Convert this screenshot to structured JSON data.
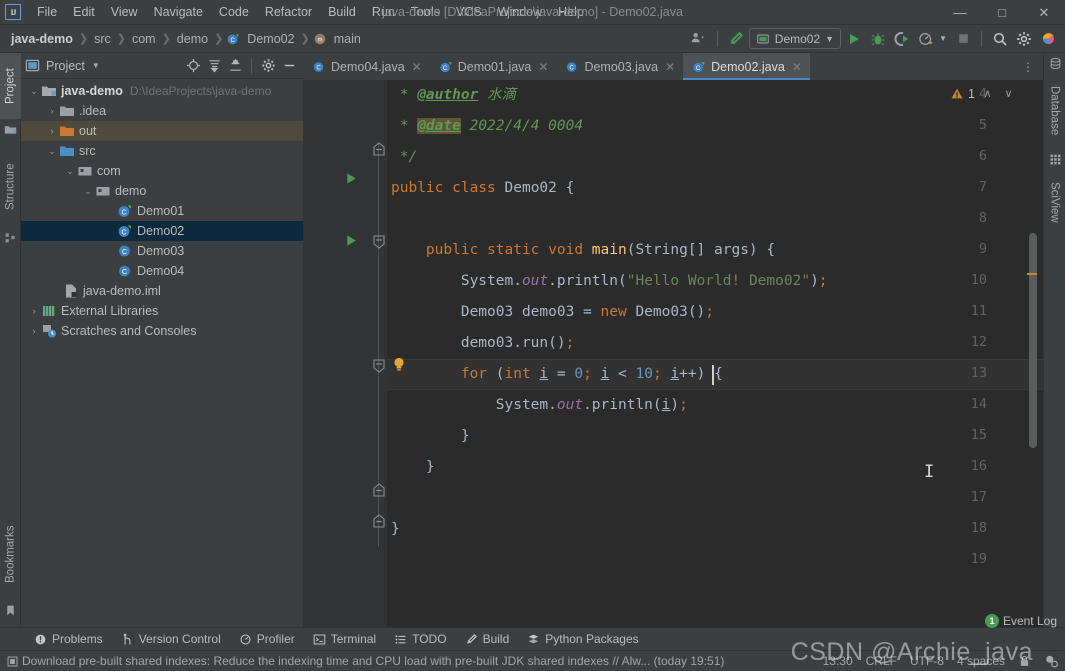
{
  "window": {
    "title": "java-demo [D:\\IdeaProjects\\java-demo] - Demo02.java",
    "logo": "IJ",
    "minimize": "—",
    "maximize": "□",
    "close": "✕"
  },
  "menu": [
    "File",
    "Edit",
    "View",
    "Navigate",
    "Code",
    "Refactor",
    "Build",
    "Run",
    "Tools",
    "VCS",
    "Window",
    "Help"
  ],
  "breadcrumb": [
    {
      "label": "java-demo",
      "icon": ""
    },
    {
      "label": "src",
      "icon": ""
    },
    {
      "label": "com",
      "icon": ""
    },
    {
      "label": "demo",
      "icon": ""
    },
    {
      "label": "Demo02",
      "icon": "class-icon"
    },
    {
      "label": "main",
      "icon": "method-icon"
    }
  ],
  "toolbar": {
    "run_config": "Demo02",
    "buttons": [
      "people-icon",
      "hammer-icon",
      "run-icon",
      "debug-icon",
      "coverage-icon",
      "profile-icon",
      "stop-icon",
      "search-icon",
      "settings-icon",
      "plugin-icon"
    ]
  },
  "left_stripe": [
    {
      "label": "Project",
      "active": true
    },
    {
      "label": "Structure",
      "active": false
    },
    {
      "label": "Bookmarks",
      "active": false
    }
  ],
  "right_stripe": [
    {
      "label": "Database"
    },
    {
      "label": "SciView"
    }
  ],
  "project_panel": {
    "title": "Project",
    "tools": [
      "locate-icon",
      "expand-all-icon",
      "collapse-all-icon",
      "gear-icon",
      "minimize-icon"
    ],
    "tree": [
      {
        "label": "java-demo",
        "path": "D:\\IdeaProjects\\java-demo",
        "indent": 0,
        "arrow": "⌄",
        "icon": "module-icon",
        "bold": true,
        "state": "normal"
      },
      {
        "label": ".idea",
        "path": "",
        "indent": 1,
        "arrow": "›",
        "icon": "folder-gray-icon",
        "bold": false,
        "state": "normal"
      },
      {
        "label": "out",
        "path": "",
        "indent": 1,
        "arrow": "›",
        "icon": "folder-orange-icon",
        "bold": false,
        "state": "hover"
      },
      {
        "label": "src",
        "path": "",
        "indent": 1,
        "arrow": "⌄",
        "icon": "folder-blue-icon",
        "bold": false,
        "state": "normal"
      },
      {
        "label": "com",
        "path": "",
        "indent": 2,
        "arrow": "⌄",
        "icon": "package-icon",
        "bold": false,
        "state": "normal"
      },
      {
        "label": "demo",
        "path": "",
        "indent": 3,
        "arrow": "⌄",
        "icon": "package-icon",
        "bold": false,
        "state": "normal"
      },
      {
        "label": "Demo01",
        "path": "",
        "indent": 4,
        "arrow": "",
        "icon": "class-run-icon",
        "bold": false,
        "state": "normal"
      },
      {
        "label": "Demo02",
        "path": "",
        "indent": 4,
        "arrow": "",
        "icon": "class-run-icon",
        "bold": false,
        "state": "selected"
      },
      {
        "label": "Demo03",
        "path": "",
        "indent": 4,
        "arrow": "",
        "icon": "class-icon",
        "bold": false,
        "state": "normal"
      },
      {
        "label": "Demo04",
        "path": "",
        "indent": 4,
        "arrow": "",
        "icon": "class-icon",
        "bold": false,
        "state": "normal"
      },
      {
        "label": "java-demo.iml",
        "path": "",
        "indent": 2,
        "arrow": "",
        "icon": "iml-icon",
        "bold": false,
        "state": "normal"
      },
      {
        "label": "External Libraries",
        "path": "",
        "indent": 0,
        "arrow": "›",
        "icon": "libraries-icon",
        "bold": false,
        "state": "normal"
      },
      {
        "label": "Scratches and Consoles",
        "path": "",
        "indent": 0,
        "arrow": "›",
        "icon": "scratches-icon",
        "bold": false,
        "state": "normal"
      }
    ]
  },
  "editor": {
    "tabs": [
      {
        "label": "Demo04.java",
        "icon": "class-icon",
        "active": false
      },
      {
        "label": "Demo01.java",
        "icon": "class-run-icon",
        "active": false
      },
      {
        "label": "Demo03.java",
        "icon": "class-icon",
        "active": false
      },
      {
        "label": "Demo02.java",
        "icon": "class-run-icon",
        "active": true
      }
    ],
    "tab_close": "✕",
    "tabs_more": "⋮",
    "inspection": {
      "count": "1",
      "up": "∧",
      "down": "∨"
    },
    "first_line": 4,
    "lines": [
      {
        "num": "4",
        "text": " * @author 水滴"
      },
      {
        "num": "5",
        "text": " * @date 2022/4/4 0004"
      },
      {
        "num": "6",
        "text": " */"
      },
      {
        "num": "7",
        "text": "public class Demo02 {"
      },
      {
        "num": "8",
        "text": ""
      },
      {
        "num": "9",
        "text": "    public static void main(String[] args) {"
      },
      {
        "num": "10",
        "text": "        System.out.println(\"Hello World! Demo02\");"
      },
      {
        "num": "11",
        "text": "        Demo03 demo03 = new Demo03();"
      },
      {
        "num": "12",
        "text": "        demo03.run();"
      },
      {
        "num": "13",
        "text": "        for (int i = 0; i < 10; i++) {"
      },
      {
        "num": "14",
        "text": "            System.out.println(i);"
      },
      {
        "num": "15",
        "text": "        }"
      },
      {
        "num": "16",
        "text": "    }"
      },
      {
        "num": "17",
        "text": ""
      },
      {
        "num": "18",
        "text": "}"
      },
      {
        "num": "19",
        "text": ""
      }
    ],
    "current_line": "13",
    "author_tag": "@author",
    "author_value": "水滴",
    "date_tag": "@date",
    "date_value": "2022/4/4 0004"
  },
  "tool_windows": [
    {
      "label": "Problems",
      "icon": "problems-icon"
    },
    {
      "label": "Version Control",
      "icon": "vcs-icon"
    },
    {
      "label": "Profiler",
      "icon": "profiler-icon"
    },
    {
      "label": "Terminal",
      "icon": "terminal-icon"
    },
    {
      "label": "TODO",
      "icon": "todo-icon"
    },
    {
      "label": "Build",
      "icon": "build-icon"
    },
    {
      "label": "Python Packages",
      "icon": "python-icon"
    }
  ],
  "event_log": {
    "label": "Event Log",
    "badge": "1"
  },
  "status_bar": {
    "message": "Download pre-built shared indexes: Reduce the indexing time and CPU load with pre-built JDK shared indexes // Alw... (today 19:51)",
    "position": "13:30",
    "line_sep": "CRLF",
    "encoding": "UTF-8",
    "indent": "4 spaces",
    "lock": "lock-icon",
    "inspector": "inspector-icon"
  },
  "watermark": "CSDN @Archie_java",
  "colors": {
    "accent": "#4a88c7",
    "keyword": "#cc7832",
    "string": "#6a8759",
    "number": "#6897bb",
    "comment": "#629755",
    "field": "#9876aa",
    "editor_bg": "#2b2b2b",
    "panel_bg": "#3c3f41",
    "selection": "#0d293e",
    "warning": "#bd8b36"
  }
}
